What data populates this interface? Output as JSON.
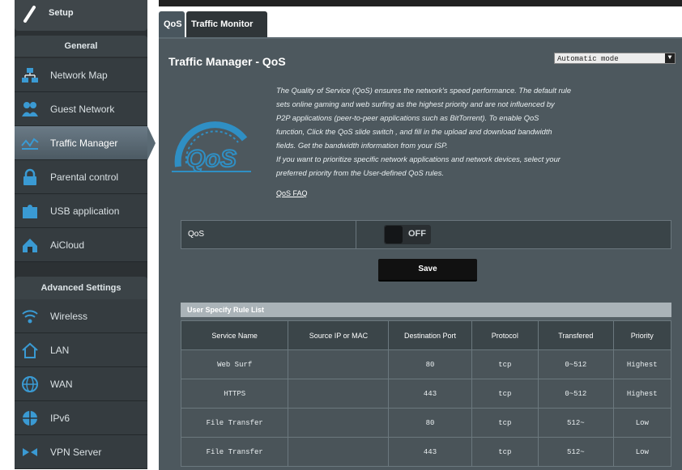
{
  "sidebar": {
    "setup_label": "Setup",
    "general": {
      "title": "General",
      "items": [
        {
          "label": "Network Map"
        },
        {
          "label": "Guest Network"
        },
        {
          "label": "Traffic Manager"
        },
        {
          "label": "Parental control"
        },
        {
          "label": "USB application"
        },
        {
          "label": "AiCloud"
        }
      ]
    },
    "advanced": {
      "title": "Advanced Settings",
      "items": [
        {
          "label": "Wireless"
        },
        {
          "label": "LAN"
        },
        {
          "label": "WAN"
        },
        {
          "label": "IPv6"
        },
        {
          "label": "VPN Server"
        }
      ]
    }
  },
  "tabs": [
    {
      "label": "QoS"
    },
    {
      "label": "Traffic Monitor"
    }
  ],
  "page": {
    "title": "Traffic Manager - QoS",
    "mode_select": "Automatic mode",
    "gauge_text": "QoS",
    "description": [
      "The Quality of Service (QoS) ensures the network's speed performance. The default rule",
      "sets online gaming and web surfing as the highest priority and are not influenced by",
      "P2P applications (peer-to-peer applications such as BitTorrent). To enable QoS",
      "function, Click the QoS slide switch , and fill in the upload and download bandwidth",
      "fields. Get the bandwidth information from your ISP.",
      "If you want to prioritize specific network applications and network devices, select your",
      "preferred priority from the User-defined QoS rules."
    ],
    "faq_link": "QoS FAQ",
    "qos_label": "QoS",
    "toggle_label": "OFF",
    "save_label": "Save"
  },
  "rules": {
    "title": "User Specify Rule List",
    "columns": [
      "Service Name",
      "Source IP or MAC",
      "Destination Port",
      "Protocol",
      "Transfered",
      "Priority"
    ],
    "rows": [
      [
        "Web Surf",
        "",
        "80",
        "tcp",
        "0~512",
        "Highest"
      ],
      [
        "HTTPS",
        "",
        "443",
        "tcp",
        "0~512",
        "Highest"
      ],
      [
        "File Transfer",
        "",
        "80",
        "tcp",
        "512~",
        "Low"
      ],
      [
        "File Transfer",
        "",
        "443",
        "tcp",
        "512~",
        "Low"
      ]
    ]
  },
  "colors": {
    "panel": "#4d585e",
    "sidebar": "#2c3134",
    "accent_blue": "#2f8fc4"
  }
}
